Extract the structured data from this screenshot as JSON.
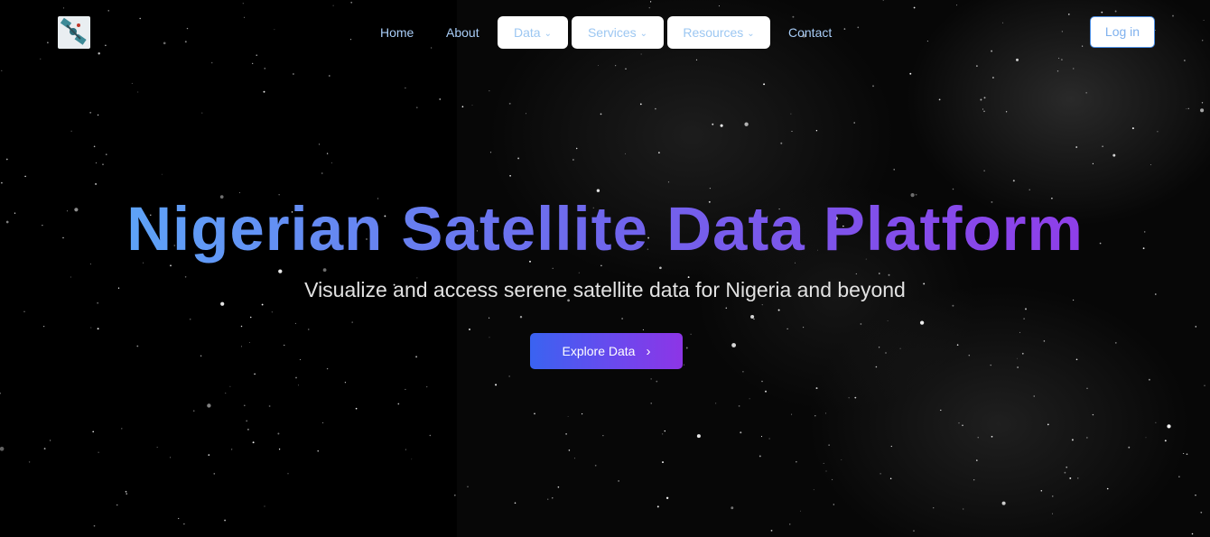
{
  "nav": {
    "logo_icon": "satellite-icon",
    "home": "Home",
    "about": "About",
    "data": "Data",
    "services": "Services",
    "resources": "Resources",
    "contact": "Contact",
    "login": "Log in",
    "chevron_icon": "chevron-down-icon"
  },
  "hero": {
    "title": "Nigerian Satellite Data Platform",
    "subtitle": "Visualize and access serene satellite data for Nigeria and beyond",
    "cta_label": "Explore Data",
    "cta_icon": "chevron-right-icon"
  },
  "colors": {
    "background": "#000000",
    "nav_link": "#a9cdf7",
    "title_gradient_start": "#5ea3f7",
    "title_gradient_end": "#8f3ee9",
    "cta_gradient_start": "#3a63f1",
    "cta_gradient_end": "#8d35e6"
  }
}
